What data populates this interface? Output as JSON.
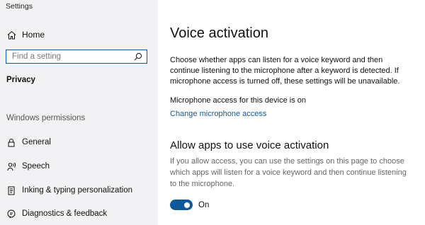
{
  "window": {
    "title": "Settings"
  },
  "sidebar": {
    "home_label": "Home",
    "search": {
      "placeholder": "Find a setting",
      "value": ""
    },
    "current_section": "Privacy",
    "group_header": "Windows permissions",
    "items": [
      {
        "label": "General",
        "icon": "lock-icon"
      },
      {
        "label": "Speech",
        "icon": "speech-icon"
      },
      {
        "label": "Inking & typing personalization",
        "icon": "inking-icon"
      },
      {
        "label": "Diagnostics & feedback",
        "icon": "diagnostics-icon"
      }
    ]
  },
  "main": {
    "title": "Voice activation",
    "description": "Choose whether apps can listen for a voice keyword and then continue listening to the microphone after a keyword is detected. If microphone access is turned off, these settings will be unavailable.",
    "mic_status": "Microphone access for this device is on",
    "change_link": "Change microphone access",
    "section": {
      "title": "Allow apps to use voice activation",
      "description": "If you allow access, you can use the settings on this page to choose which apps will listen for a voice keyword and then continue listening to the microphone.",
      "toggle_label": "On",
      "toggle_on": true
    }
  },
  "colors": {
    "accent": "#0c5a9a",
    "sidebar_bg": "#f2f1f4",
    "link": "#0c5a9a"
  }
}
